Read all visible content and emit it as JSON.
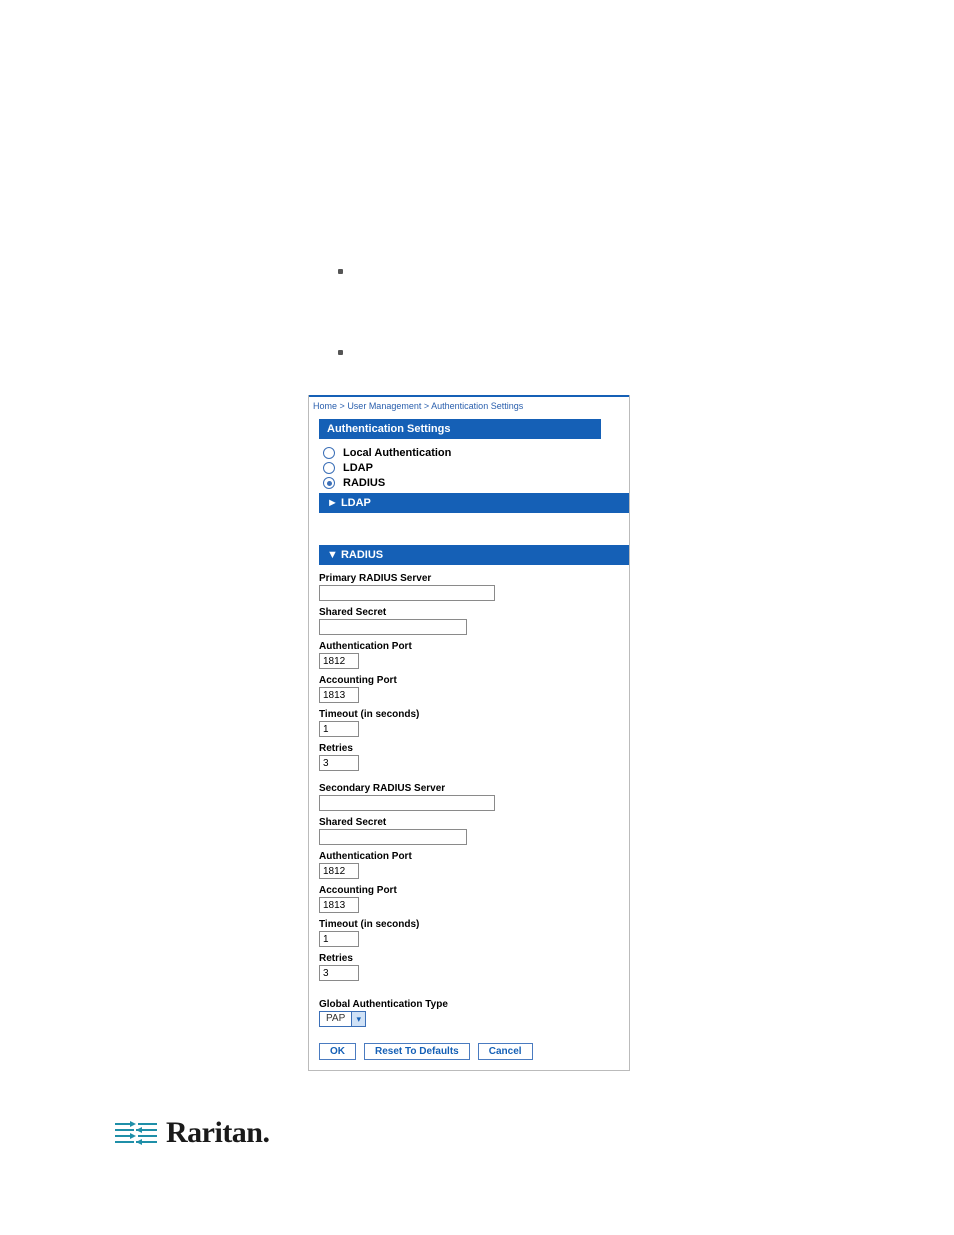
{
  "doc": {
    "bullet1": "",
    "bullet2": ""
  },
  "breadcrumb": {
    "home": "Home",
    "sep": ">",
    "usermgmt": "User Management",
    "authset": "Authentication Settings"
  },
  "panel": {
    "title": "Authentication Settings",
    "radios": {
      "local": "Local Authentication",
      "ldap": "LDAP",
      "radius": "RADIUS"
    },
    "sections": {
      "ldap": "► LDAP",
      "radius": "▼ RADIUS"
    },
    "radiusForm": {
      "primaryServerLabel": "Primary RADIUS Server",
      "primaryServer": "",
      "sharedSecretLabel": "Shared Secret",
      "sharedSecret": "",
      "authPortLabel": "Authentication Port",
      "authPort": "1812",
      "acctPortLabel": "Accounting Port",
      "acctPort": "1813",
      "timeoutLabel": "Timeout (in seconds)",
      "timeout": "1",
      "retriesLabel": "Retries",
      "retries": "3",
      "secondaryServerLabel": "Secondary RADIUS Server",
      "secondaryServer": "",
      "sharedSecret2Label": "Shared Secret",
      "sharedSecret2": "",
      "authPort2Label": "Authentication Port",
      "authPort2": "1812",
      "acctPort2Label": "Accounting Port",
      "acctPort2": "1813",
      "timeout2Label": "Timeout (in seconds)",
      "timeout2": "1",
      "retries2Label": "Retries",
      "retries2": "3",
      "globalAuthLabel": "Global Authentication Type",
      "globalAuthValue": "PAP"
    },
    "actions": {
      "ok": "OK",
      "reset": "Reset To Defaults",
      "cancel": "Cancel"
    }
  },
  "logo": {
    "text": "Raritan."
  }
}
